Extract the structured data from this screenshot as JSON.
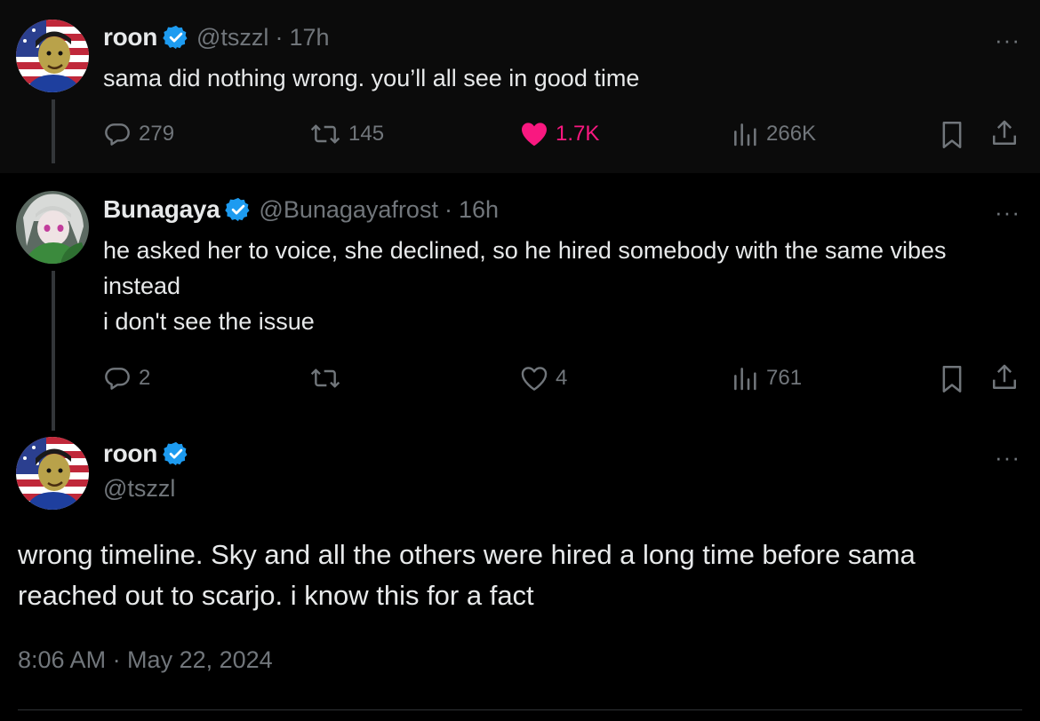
{
  "colors": {
    "background": "#000000",
    "highlight_background": "#0b0b0b",
    "text": "#e7e9ea",
    "secondary": "#71767b",
    "verified": "#1d9bf0",
    "like": "#f91880"
  },
  "tweets": [
    {
      "name": "roon",
      "handle": "@tszzl",
      "separator": "·",
      "time": "17h",
      "more": "···",
      "text": "sama did nothing wrong. you’ll all see in good time",
      "stats": {
        "replies": "279",
        "reposts": "145",
        "likes": "1.7K",
        "views": "266K"
      },
      "icons": [
        "reply-icon",
        "repost-icon",
        "heart-filled-icon",
        "views-icon",
        "bookmark-icon",
        "share-icon"
      ]
    },
    {
      "name": "Bunagaya",
      "handle": "@Bunagayafrost",
      "separator": "·",
      "time": "16h",
      "more": "···",
      "text": "he asked her to voice, she declined, so he hired somebody with the same vibes instead\ni don't see the issue",
      "stats": {
        "replies": "2",
        "reposts": "",
        "likes": "4",
        "views": "761"
      },
      "icons": [
        "reply-icon",
        "repost-icon",
        "heart-outline-icon",
        "views-icon",
        "bookmark-icon",
        "share-icon"
      ]
    }
  ],
  "main_tweet": {
    "name": "roon",
    "handle": "@tszzl",
    "more": "···",
    "text": "wrong timeline. Sky and all the others were hired a long time before sama reached out to scarjo. i know this for a fact",
    "timestamp": "8:06 AM · May 22, 2024"
  }
}
